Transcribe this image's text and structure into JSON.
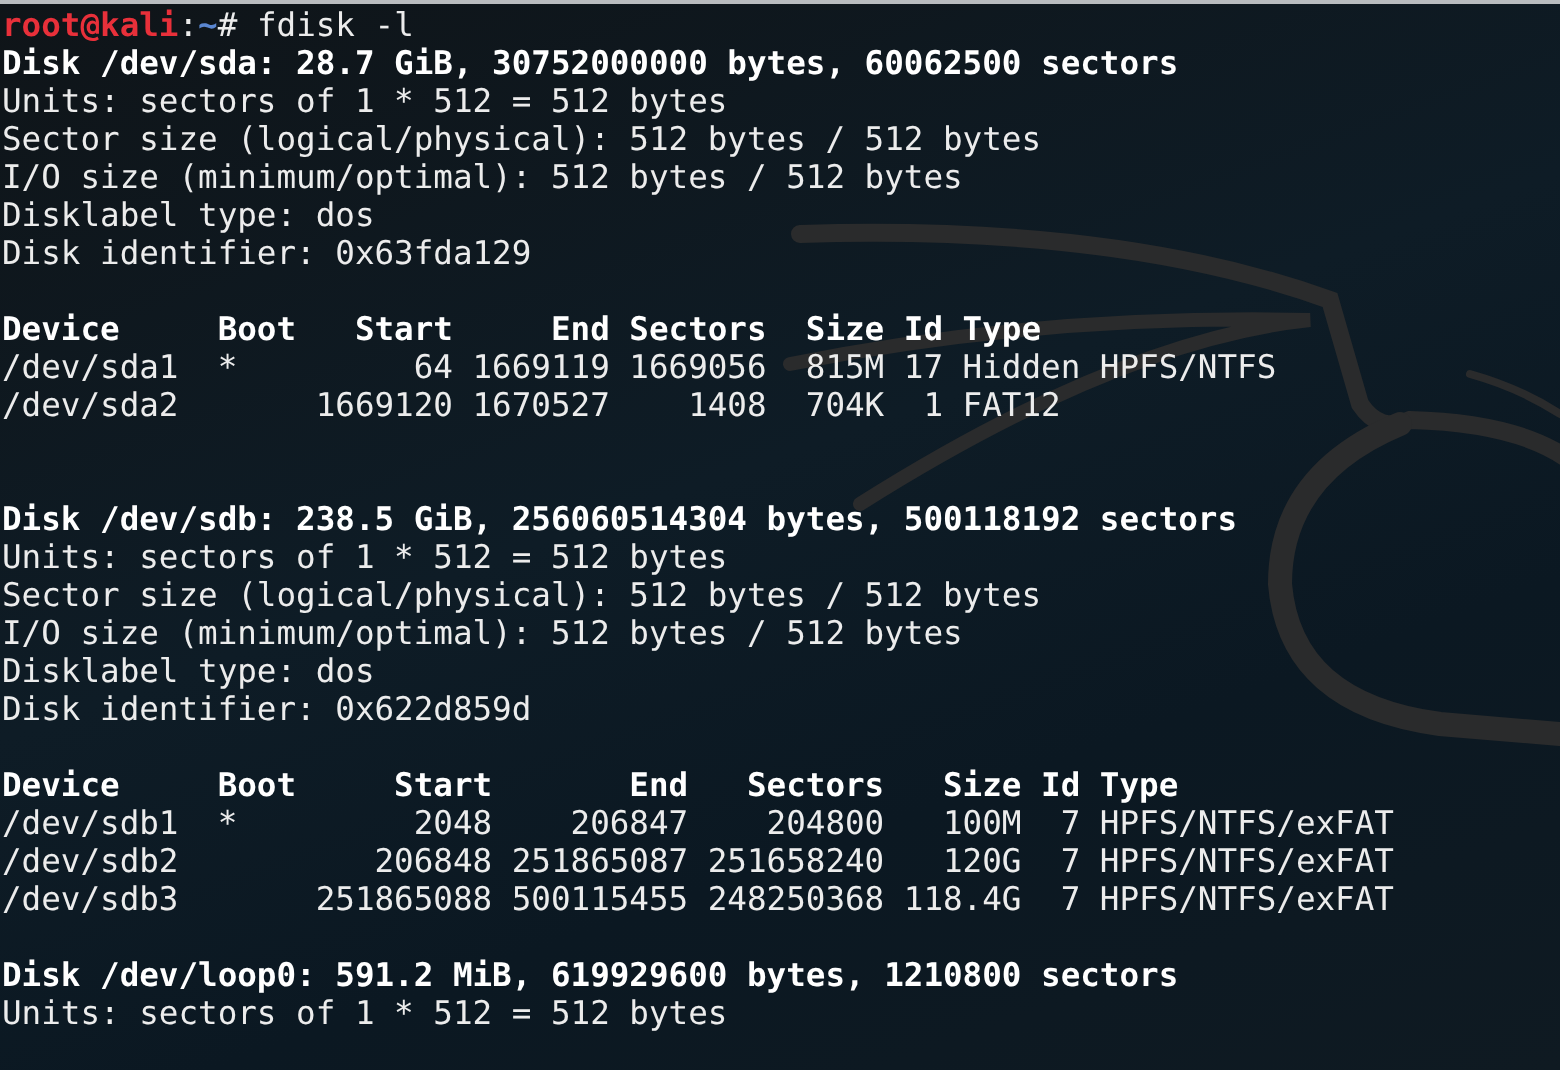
{
  "terminal": {
    "prompt": {
      "user": "root@kali",
      "separator": ":",
      "path": "~",
      "symbol": "#",
      "command": " fdisk -l"
    },
    "lines": [
      {
        "kind": "bold",
        "text": "Disk /dev/sda: 28.7 GiB, 30752000000 bytes, 60062500 sectors"
      },
      {
        "kind": "text",
        "text": "Units: sectors of 1 * 512 = 512 bytes"
      },
      {
        "kind": "text",
        "text": "Sector size (logical/physical): 512 bytes / 512 bytes"
      },
      {
        "kind": "text",
        "text": "I/O size (minimum/optimal): 512 bytes / 512 bytes"
      },
      {
        "kind": "text",
        "text": "Disklabel type: dos"
      },
      {
        "kind": "text",
        "text": "Disk identifier: 0x63fda129"
      },
      {
        "kind": "blank"
      },
      {
        "kind": "bold",
        "text": "Device     Boot   Start     End Sectors  Size Id Type"
      },
      {
        "kind": "text",
        "text": "/dev/sda1  *         64 1669119 1669056  815M 17 Hidden HPFS/NTFS"
      },
      {
        "kind": "text",
        "text": "/dev/sda2       1669120 1670527    1408  704K  1 FAT12"
      },
      {
        "kind": "blank"
      },
      {
        "kind": "blank"
      },
      {
        "kind": "bold",
        "text": "Disk /dev/sdb: 238.5 GiB, 256060514304 bytes, 500118192 sectors"
      },
      {
        "kind": "text",
        "text": "Units: sectors of 1 * 512 = 512 bytes"
      },
      {
        "kind": "text",
        "text": "Sector size (logical/physical): 512 bytes / 512 bytes"
      },
      {
        "kind": "text",
        "text": "I/O size (minimum/optimal): 512 bytes / 512 bytes"
      },
      {
        "kind": "text",
        "text": "Disklabel type: dos"
      },
      {
        "kind": "text",
        "text": "Disk identifier: 0x622d859d"
      },
      {
        "kind": "blank"
      },
      {
        "kind": "bold",
        "text": "Device     Boot     Start       End   Sectors   Size Id Type"
      },
      {
        "kind": "text",
        "text": "/dev/sdb1  *         2048    206847    204800   100M  7 HPFS/NTFS/exFAT"
      },
      {
        "kind": "text",
        "text": "/dev/sdb2          206848 251865087 251658240   120G  7 HPFS/NTFS/exFAT"
      },
      {
        "kind": "text",
        "text": "/dev/sdb3       251865088 500115455 248250368 118.4G  7 HPFS/NTFS/exFAT"
      },
      {
        "kind": "blank"
      },
      {
        "kind": "bold",
        "text": "Disk /dev/loop0: 591.2 MiB, 619929600 bytes, 1210800 sectors"
      },
      {
        "kind": "text",
        "text": "Units: sectors of 1 * 512 = 512 bytes"
      }
    ]
  }
}
